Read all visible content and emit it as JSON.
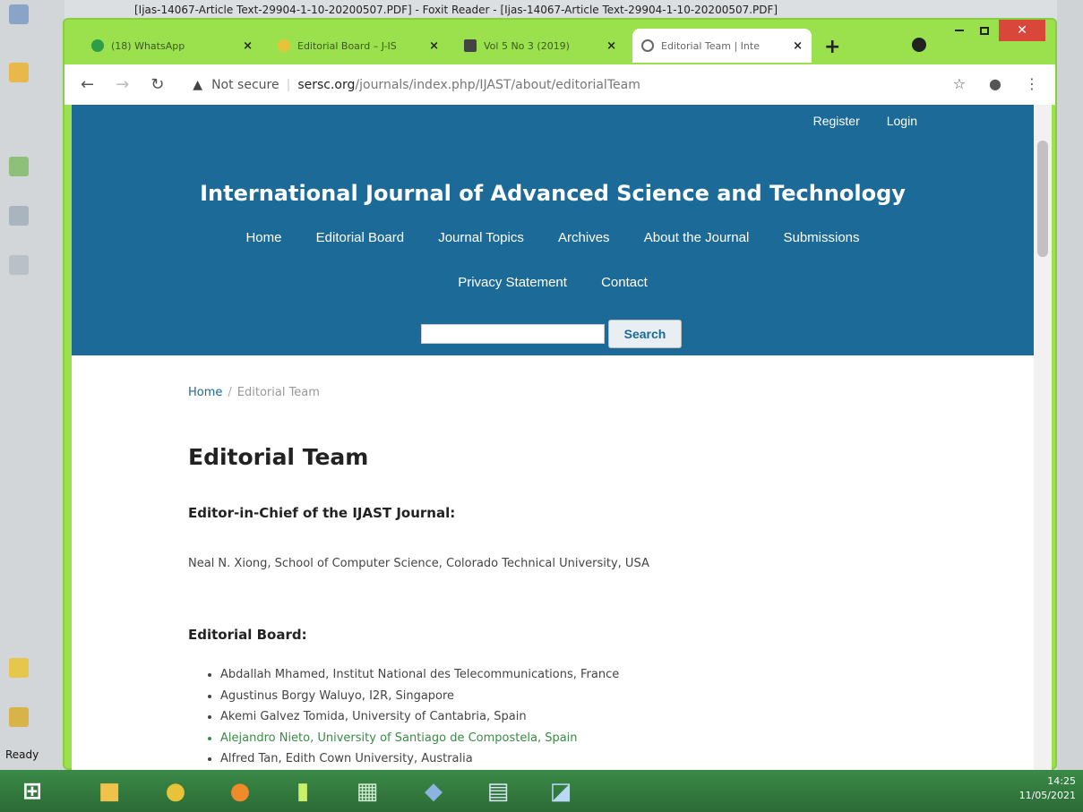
{
  "background_app": {
    "title_text": "[Ijas-14067-Article Text-29904-1-10-20200507.PDF] - Foxit Reader - [Ijas-14067-Article Text-29904-1-10-20200507.PDF]",
    "status": "Ready"
  },
  "browser": {
    "tabs": [
      {
        "label": "(18) WhatsApp",
        "close": "×",
        "icon_color": "#2e9d4a"
      },
      {
        "label": "Editorial Board – J-IS",
        "close": "×",
        "icon_color": "#e8c33a"
      },
      {
        "label": "Vol 5 No 3 (2019)",
        "close": "×",
        "icon_color": "#444444"
      },
      {
        "label": "Editorial Team | Inte",
        "close": "×",
        "icon_color": "#666666"
      }
    ],
    "new_tab": "+",
    "address": {
      "security": "Not secure",
      "domain": "sersc.org",
      "path": "/journals/index.php/IJAST/about/editorialTeam"
    }
  },
  "site": {
    "top_links": {
      "register": "Register",
      "login": "Login"
    },
    "title": "International Journal of Advanced Science and Technology",
    "menu_row1": [
      "Home",
      "Editorial Board",
      "Journal Topics",
      "Archives",
      "About the Journal",
      "Submissions"
    ],
    "menu_row2": [
      "Privacy Statement",
      "Contact"
    ],
    "search_button": "Search"
  },
  "page": {
    "breadcrumb": {
      "home": "Home",
      "separator": "/",
      "current": "Editorial Team"
    },
    "heading": "Editorial Team",
    "chief_heading": "Editor-in-Chief of the IJAST Journal:",
    "chief_text": "Neal N. Xiong, School of Computer Science, Colorado Technical University, USA",
    "board_heading": "Editorial Board:",
    "board_members": [
      "Abdallah Mhamed, Institut National des Telecommunications, France",
      "Agustinus Borgy Waluyo, I2R, Singapore",
      "Akemi Galvez Tomida, University of Cantabria, Spain",
      "Alejandro Nieto, University of Santiago de Compostela, Spain",
      "Alfred Tan, Edith Cown University, Australia"
    ]
  },
  "taskbar": {
    "time": "14:25",
    "date": "11/05/2021"
  },
  "colors": {
    "header_blue": "#1b6a97",
    "window_green": "#9be04d"
  }
}
